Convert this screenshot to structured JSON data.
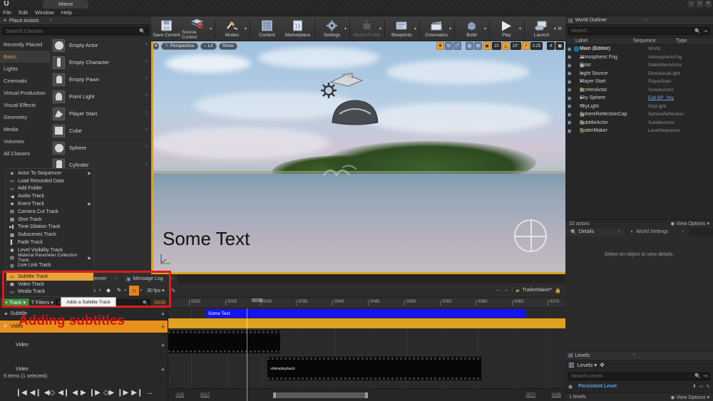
{
  "window": {
    "title": "Maine",
    "minimize": "–",
    "maximize": "□",
    "close": "×"
  },
  "menubar": {
    "items": [
      "File",
      "Edit",
      "Window",
      "Help"
    ]
  },
  "place_actors": {
    "tab_label": "Place Actors",
    "search_placeholder": "Search Classes",
    "categories": [
      {
        "label": "Recently Placed",
        "selected": false
      },
      {
        "label": "Basic",
        "selected": true
      },
      {
        "label": "Lights",
        "selected": false
      },
      {
        "label": "Cinematic",
        "selected": false
      },
      {
        "label": "Virtual Production",
        "selected": false
      },
      {
        "label": "Visual Effects",
        "selected": false
      },
      {
        "label": "Geometry",
        "selected": false
      },
      {
        "label": "Media",
        "selected": false
      },
      {
        "label": "Volumes",
        "selected": false
      },
      {
        "label": "All Classes",
        "selected": false
      }
    ],
    "items": [
      {
        "label": "Empty Actor",
        "help": "?"
      },
      {
        "label": "Empty Character",
        "help": "?"
      },
      {
        "label": "Empty Pawn",
        "help": "?"
      },
      {
        "label": "Point Light",
        "help": "?"
      },
      {
        "label": "Player Start",
        "help": "?"
      },
      {
        "label": "Cube",
        "help": "?"
      },
      {
        "label": "Sphere",
        "help": "?"
      },
      {
        "label": "Cylinder",
        "help": "?"
      }
    ]
  },
  "track_menu": {
    "items": [
      {
        "label": "Actor To Sequencer",
        "icon": "actor-icon",
        "glyph": "◈",
        "submenu": "▶"
      },
      {
        "label": "Load Recorded Data",
        "icon": "folder-icon",
        "glyph": "▭",
        "submenu": ""
      },
      {
        "label": "Add Folder",
        "icon": "folder-icon",
        "glyph": "▭",
        "submenu": ""
      },
      {
        "label": "Audio Track",
        "icon": "audio-icon",
        "glyph": "◀",
        "submenu": ""
      },
      {
        "label": "Event Track",
        "icon": "flag-icon",
        "glyph": "⚑",
        "submenu": "▶"
      },
      {
        "label": "Camera Cut Track",
        "icon": "camera-icon",
        "glyph": "▤",
        "submenu": ""
      },
      {
        "label": "Shot Track",
        "icon": "shot-icon",
        "glyph": "▦",
        "submenu": ""
      },
      {
        "label": "Time Dilation Track",
        "icon": "time-icon",
        "glyph": "▶▌",
        "submenu": ""
      },
      {
        "label": "Subscenes Track",
        "icon": "subscene-icon",
        "glyph": "▩",
        "submenu": ""
      },
      {
        "label": "Fade Track",
        "icon": "fade-icon",
        "glyph": "▌",
        "submenu": ""
      },
      {
        "label": "Level Visibility Track",
        "icon": "eye-icon",
        "glyph": "◉",
        "submenu": ""
      },
      {
        "label": "Material Parameter Collection Track",
        "icon": "material-icon",
        "glyph": "▤",
        "submenu": "▶"
      },
      {
        "label": "Live Link Track",
        "icon": "livelink-icon",
        "glyph": "◍",
        "submenu": ""
      }
    ],
    "sub_items": [
      {
        "label": "Subtitle Track",
        "icon": "subtitle-icon",
        "glyph": "▭",
        "highlighted": true
      },
      {
        "label": "Video Track",
        "icon": "video-icon",
        "glyph": "▣",
        "highlighted": false
      },
      {
        "label": "Media Track",
        "icon": "media-icon",
        "glyph": "▭",
        "highlighted": false
      }
    ],
    "tooltip": "Adds a Subtitle Track"
  },
  "annotation": {
    "text": "Adding subtitles",
    "color": "#d61111"
  },
  "toolbar": {
    "buttons": [
      {
        "label": "Save Current",
        "icon": "save-icon",
        "caret": false,
        "dim": false
      },
      {
        "label": "Source Control",
        "icon": "source-control-icon",
        "caret": true,
        "dim": false
      },
      {
        "label": "Modes",
        "icon": "modes-icon",
        "caret": true,
        "dim": false
      },
      {
        "label": "Content",
        "icon": "content-icon",
        "caret": false,
        "dim": false
      },
      {
        "label": "Marketplace",
        "icon": "marketplace-icon",
        "caret": false,
        "dim": false
      },
      {
        "label": "Settings",
        "icon": "settings-icon",
        "caret": true,
        "dim": false
      },
      {
        "label": "Media Profile",
        "icon": "media-profile-icon",
        "caret": true,
        "dim": true
      },
      {
        "label": "Blueprints",
        "icon": "blueprints-icon",
        "caret": true,
        "dim": false
      },
      {
        "label": "Cinematics",
        "icon": "cinematics-icon",
        "caret": true,
        "dim": false
      },
      {
        "label": "Build",
        "icon": "build-icon",
        "caret": true,
        "dim": false
      },
      {
        "label": "Play",
        "icon": "play-icon",
        "caret": true,
        "dim": false
      },
      {
        "label": "Launch",
        "icon": "launch-icon",
        "caret": true,
        "dim": false
      }
    ],
    "overflow": "»"
  },
  "viewport": {
    "perspective": "Perspective",
    "lit": "Lit",
    "show": "Show",
    "subtitle_text": "Some Text",
    "gizmo_buttons": [
      {
        "label": "",
        "icon": "move-icon",
        "glyph": "✥",
        "active": true
      },
      {
        "label": "",
        "icon": "rotate-icon",
        "glyph": "↻",
        "active": false
      },
      {
        "label": "",
        "icon": "scale-icon",
        "glyph": "⤢",
        "active": false
      },
      {
        "label": "",
        "icon": "world-icon",
        "glyph": "◍",
        "active": false
      },
      {
        "label": "",
        "icon": "snap-icon",
        "glyph": "⊞",
        "active": false
      },
      {
        "label": "",
        "icon": "grid-snap-icon",
        "glyph": "▣",
        "active": true
      },
      {
        "label": "10",
        "icon": "grid-size-value",
        "glyph": "",
        "active": false
      },
      {
        "label": "",
        "icon": "angle-snap-icon",
        "glyph": "△",
        "active": true
      },
      {
        "label": "10°",
        "icon": "angle-size-value",
        "glyph": "",
        "active": false
      },
      {
        "label": "",
        "icon": "scale-snap-icon",
        "glyph": "↗",
        "active": true
      },
      {
        "label": "0.25",
        "icon": "scale-size-value",
        "glyph": "",
        "active": false
      },
      {
        "label": "4",
        "icon": "camera-speed-icon",
        "glyph": "🎥",
        "active": false
      }
    ]
  },
  "sequencer": {
    "tabs": [
      {
        "label": "Sequencer",
        "icon": "sequencer-icon"
      },
      {
        "label": "Message Log",
        "icon": "message-log-icon"
      }
    ],
    "toolbar": {
      "fps": "30 fps",
      "snap_glyph": "∩",
      "curve_icon": "curve-editor-icon",
      "breadcrumb": "TrailerMaker*",
      "nav_back": "←",
      "nav_fwd": "→"
    },
    "track_button": "Track",
    "filters_button": "Filters",
    "search_placeholder": "Search Tracks",
    "current_frame": "0038",
    "tracks": [
      {
        "label": "Subtitle",
        "selected": false,
        "tall": false,
        "indent": false
      },
      {
        "label": "Video",
        "selected": true,
        "tall": false,
        "indent": false
      },
      {
        "label": "Video",
        "selected": false,
        "tall": true,
        "indent": true
      },
      {
        "label": "Video",
        "selected": false,
        "tall": true,
        "indent": true
      }
    ],
    "status": "5 items (1 selected)",
    "transport_buttons": [
      "jump-to-start-icon",
      "step-back-icon",
      "prev-key-icon",
      "frame-back-icon",
      "play-reverse-icon",
      "play-icon",
      "frame-forward-icon",
      "next-key-icon",
      "step-forward-icon",
      "jump-to-end-icon",
      "loop-icon"
    ],
    "ruler_ticks": [
      "0020",
      "0025",
      "0030",
      "0035",
      "0040",
      "0045",
      "0050",
      "0055",
      "0060",
      "0065",
      "0070"
    ],
    "playhead_label": "0038",
    "subtitle_clip": "Some Text",
    "video_clip": "videoplayback",
    "scroll": {
      "left_label": "-015",
      "in_label": "0017",
      "out_label": "0072",
      "right_label": "0165"
    }
  },
  "world_outliner": {
    "tab_label": "World Outliner",
    "search_placeholder": "Search...",
    "columns": [
      "Label",
      "Sequence",
      "Type"
    ],
    "rows": [
      {
        "label": "Main (Editor)",
        "type": "World",
        "indent": 0,
        "icon": "world-icon",
        "link": false
      },
      {
        "label": "Atmospheric Fog",
        "type": "AtmosphericFog",
        "indent": 1,
        "icon": "fog-icon",
        "link": false
      },
      {
        "label": "Floor",
        "type": "StaticMeshActor",
        "indent": 1,
        "icon": "mesh-icon",
        "link": false
      },
      {
        "label": "Light Source",
        "type": "DirectionalLight",
        "indent": 1,
        "icon": "light-icon",
        "link": false
      },
      {
        "label": "Player Start",
        "type": "PlayerStart",
        "indent": 1,
        "icon": "player-icon",
        "link": false
      },
      {
        "label": "ScreenActor",
        "type": "ScreenActor",
        "indent": 1,
        "icon": "actor-icon",
        "link": false
      },
      {
        "label": "Sky Sphere",
        "type": "Edit BP_Sky",
        "indent": 1,
        "icon": "sphere-icon",
        "link": true
      },
      {
        "label": "SkyLight",
        "type": "SkyLight",
        "indent": 1,
        "icon": "skylight-icon",
        "link": false
      },
      {
        "label": "SphereReflectionCap",
        "type": "SphereReflection",
        "indent": 1,
        "icon": "reflection-icon",
        "link": false
      },
      {
        "label": "SubtitleActor",
        "type": "SubtitleActor",
        "indent": 1,
        "icon": "actor-icon",
        "link": false
      },
      {
        "label": "TrailerMaker",
        "type": "LevelSequence",
        "indent": 1,
        "icon": "sequence-icon",
        "link": false
      }
    ],
    "footer_count": "10 actors",
    "view_options": "View Options"
  },
  "details": {
    "tabs": [
      {
        "label": "Details",
        "active": true
      },
      {
        "label": "World Settings",
        "active": false
      }
    ],
    "empty_text": "Select an object to view details."
  },
  "levels": {
    "tab_label": "Levels",
    "menu_label": "Levels",
    "search_placeholder": "Search Levels",
    "rows": [
      {
        "name": "Persistent Level"
      }
    ],
    "footer_count": "1 levels",
    "view_options": "View Options"
  }
}
